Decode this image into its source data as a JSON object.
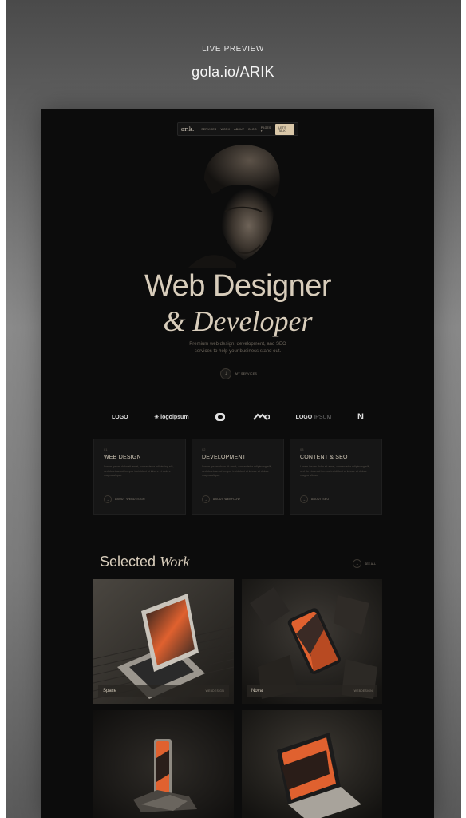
{
  "live_preview": {
    "label": "LIVE PREVIEW",
    "url": "gola.io/ARIK"
  },
  "nav": {
    "logo": "arik.",
    "items": [
      "SERVICES",
      "WORK",
      "ABOUT",
      "BLOG",
      "PAGES ▾"
    ],
    "cta": "LET'S TALK"
  },
  "hero": {
    "line1": "Web Designer",
    "line2": "& Developer",
    "subtitle_line1": "Premium web design, development, and SEO",
    "subtitle_line2": "services to help your business stand out.",
    "button_label": "MY SERVICES"
  },
  "logos": {
    "logo1": "LOGO",
    "logo2": "logoipsum",
    "logo3": "",
    "logo4": "",
    "logo5_bold": "LOGO",
    "logo5_faint": "IPSUM",
    "logo6": "N"
  },
  "services": [
    {
      "num": "01",
      "title": "WEB DESIGN",
      "text": "Lorem ipsum dolor sit amet, consectetur adipiscing elit, sed do eiusmod tempor incididunt ut labore et dolore magna aliqua.",
      "link": "ABOUT WEBDESIGN"
    },
    {
      "num": "02",
      "title": "DEVELOPMENT",
      "text": "Lorem ipsum dolor sit amet, consectetur adipiscing elit, sed do eiusmod tempor incididunt ut labore et dolore magna aliqua.",
      "link": "ABOUT WEBFLOW"
    },
    {
      "num": "03",
      "title": "CONTENT & SEO",
      "text": "Lorem ipsum dolor sit amet, consectetur adipiscing elit, sed do eiusmod tempor incididunt ut labore et dolore magna aliqua.",
      "link": "ABOUT SEO"
    }
  ],
  "work": {
    "title_plain": "Selected",
    "title_italic": "Work",
    "see_all": "SEE ALL",
    "projects": [
      {
        "name": "Space",
        "tag": "WEBDESIGN"
      },
      {
        "name": "Nova",
        "tag": "WEBDESIGN"
      }
    ]
  },
  "colors": {
    "accent": "#d9c7a8",
    "hero_text": "#d8cdbb",
    "page_bg": "#0c0c0c",
    "card_bg": "#161616",
    "artwork_orange": "#e0612f"
  },
  "icons": [
    "arrow-down-icon",
    "arrow-right-icon"
  ]
}
